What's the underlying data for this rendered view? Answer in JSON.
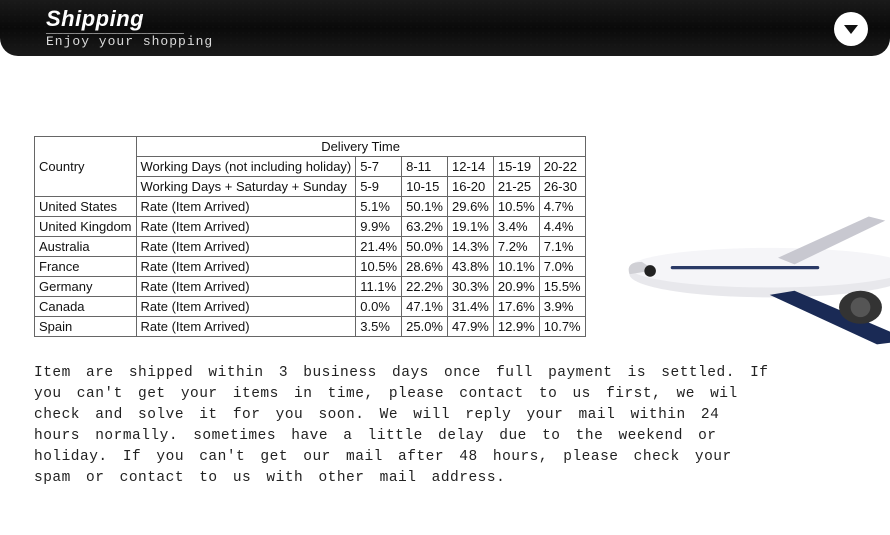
{
  "header": {
    "title": "Shipping",
    "subtitle": "Enjoy your shopping"
  },
  "table": {
    "rowHeaderLabel": "Country",
    "deliveryHeader": "Delivery Time",
    "workingDaysLabel": "Working Days (not including holiday)",
    "workingDaysCols": [
      "5-7",
      "8-11",
      "12-14",
      "15-19",
      "20-22"
    ],
    "fullDaysLabel": "Working Days + Saturday + Sunday",
    "fullDaysCols": [
      "5-9",
      "10-15",
      "16-20",
      "21-25",
      "26-30"
    ],
    "rateLabel": "Rate (Item Arrived)",
    "rows": [
      {
        "country": "United States",
        "rates": [
          "5.1%",
          "50.1%",
          "29.6%",
          "10.5%",
          "4.7%"
        ]
      },
      {
        "country": "United Kingdom",
        "rates": [
          "9.9%",
          "63.2%",
          "19.1%",
          "3.4%",
          "4.4%"
        ]
      },
      {
        "country": "Australia",
        "rates": [
          "21.4%",
          "50.0%",
          "14.3%",
          "7.2%",
          "7.1%"
        ]
      },
      {
        "country": "France",
        "rates": [
          "10.5%",
          "28.6%",
          "43.8%",
          "10.1%",
          "7.0%"
        ]
      },
      {
        "country": "Germany",
        "rates": [
          "11.1%",
          "22.2%",
          "30.3%",
          "20.9%",
          "15.5%"
        ]
      },
      {
        "country": "Canada",
        "rates": [
          "0.0%",
          "47.1%",
          "31.4%",
          "17.6%",
          "3.9%"
        ]
      },
      {
        "country": "Spain",
        "rates": [
          "3.5%",
          "25.0%",
          "47.9%",
          "12.9%",
          "10.7%"
        ]
      }
    ]
  },
  "description": "Item are shipped within 3 business days once full payment is settled. If you can't get your items in time, please contact to us first, we wil check and solve it for you soon. We will reply your mail within 24 hours normally. sometimes have a little delay due to the weekend or holiday. If you can't get our mail after 48 hours, please check your spam or contact to us with other mail address.",
  "chart_data": {
    "type": "table",
    "title": "Delivery Time",
    "row_header": "Country",
    "column_groups": {
      "Working Days (not including holiday)": [
        "5-7",
        "8-11",
        "12-14",
        "15-19",
        "20-22"
      ],
      "Working Days + Saturday + Sunday": [
        "5-9",
        "10-15",
        "16-20",
        "21-25",
        "26-30"
      ]
    },
    "value_label": "Rate (Item Arrived)",
    "categories": [
      "5-7",
      "8-11",
      "12-14",
      "15-19",
      "20-22"
    ],
    "series": [
      {
        "name": "United States",
        "values": [
          5.1,
          50.1,
          29.6,
          10.5,
          4.7
        ]
      },
      {
        "name": "United Kingdom",
        "values": [
          9.9,
          63.2,
          19.1,
          3.4,
          4.4
        ]
      },
      {
        "name": "Australia",
        "values": [
          21.4,
          50.0,
          14.3,
          7.2,
          7.1
        ]
      },
      {
        "name": "France",
        "values": [
          10.5,
          28.6,
          43.8,
          10.1,
          7.0
        ]
      },
      {
        "name": "Germany",
        "values": [
          11.1,
          22.2,
          30.3,
          20.9,
          15.5
        ]
      },
      {
        "name": "Canada",
        "values": [
          0.0,
          47.1,
          31.4,
          17.6,
          3.9
        ]
      },
      {
        "name": "Spain",
        "values": [
          3.5,
          25.0,
          47.9,
          12.9,
          10.7
        ]
      }
    ],
    "unit": "%"
  }
}
